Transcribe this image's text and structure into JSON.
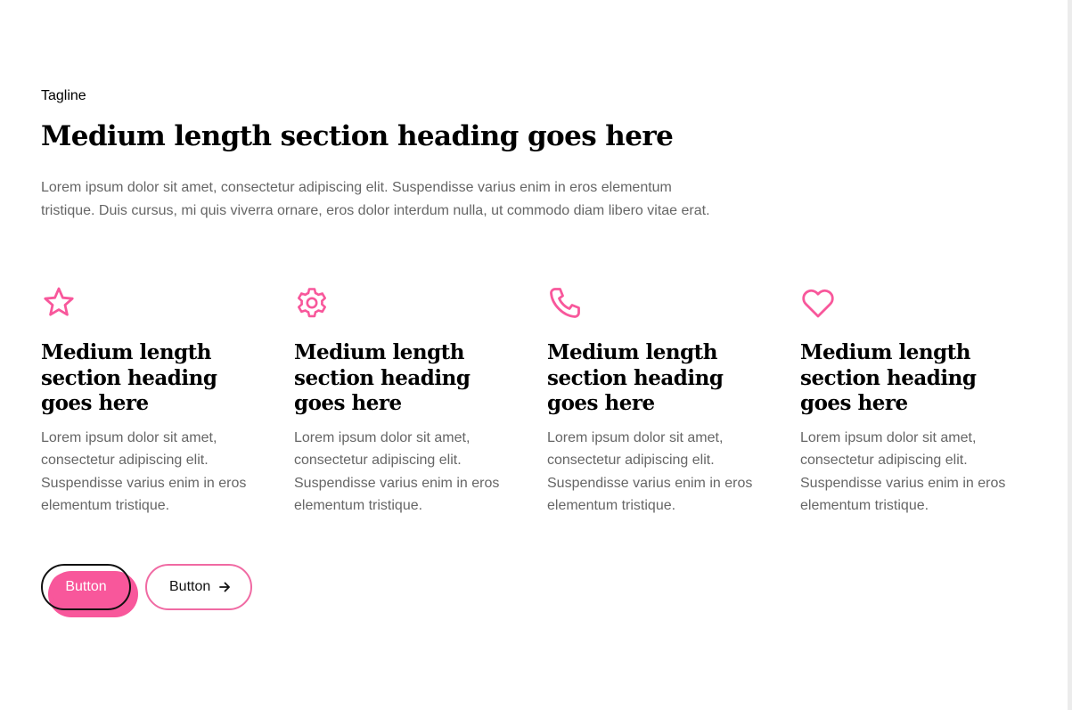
{
  "colors": {
    "accent": "#f8579b",
    "heading": "#000000",
    "body_text": "#666666",
    "button_border": "#111111",
    "button_text": "#ffffff"
  },
  "header": {
    "tagline": "Tagline",
    "title": "Medium length section heading goes here",
    "description": "Lorem ipsum dolor sit amet, consectetur adipiscing elit. Suspendisse varius enim in eros elementum tristique. Duis cursus, mi quis viverra ornare, eros dolor interdum nulla, ut commodo diam libero vitae erat."
  },
  "features": [
    {
      "icon": "star-icon",
      "heading": "Medium length section heading goes here",
      "text": "Lorem ipsum dolor sit amet, consectetur adipiscing elit. Suspendisse varius enim in eros elementum tristique."
    },
    {
      "icon": "gear-icon",
      "heading": "Medium length section heading goes here",
      "text": "Lorem ipsum dolor sit amet, consectetur adipiscing elit. Suspendisse varius enim in eros elementum tristique."
    },
    {
      "icon": "phone-icon",
      "heading": "Medium length section heading goes here",
      "text": "Lorem ipsum dolor sit amet, consectetur adipiscing elit. Suspendisse varius enim in eros elementum tristique."
    },
    {
      "icon": "heart-icon",
      "heading": "Medium length section heading goes here",
      "text": "Lorem ipsum dolor sit amet, consectetur adipiscing elit. Suspendisse varius enim in eros elementum tristique."
    }
  ],
  "actions": {
    "primary_label": "Button",
    "secondary_label": "Button",
    "secondary_icon": "arrow-right-icon"
  }
}
